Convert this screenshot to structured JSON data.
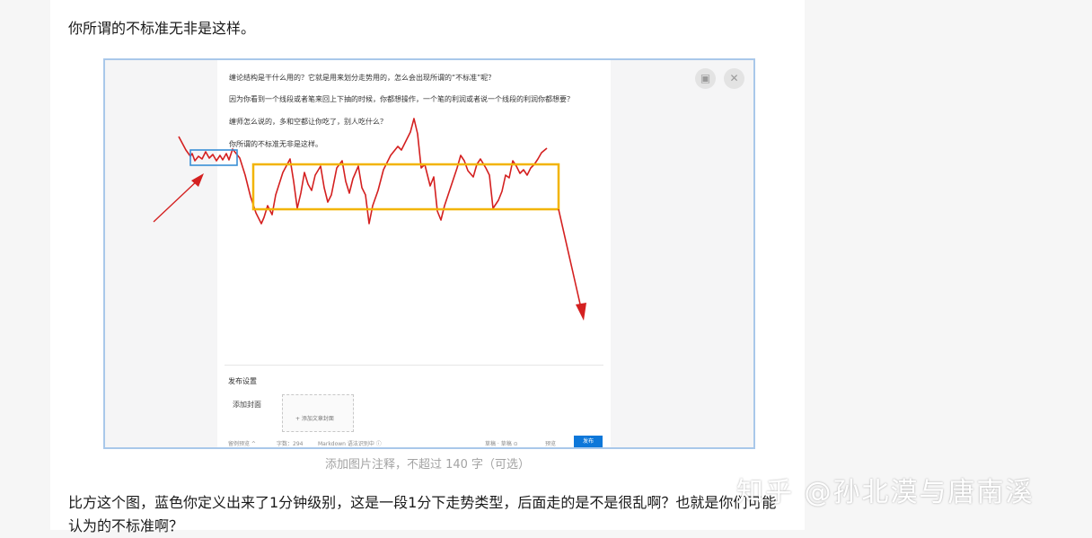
{
  "article": {
    "para1": "你所谓的不标准无非是这样。",
    "caption_placeholder": "添加图片注释，不超过 140 字（可选）",
    "para2": "比方这个图，蓝色你定义出来了1分钟级别，这是一段1分下走势类型，后面走的是不是很乱啊？也就是你们可能认为的不标准啊？"
  },
  "figure": {
    "editor_lines": [
      "缠论结构是干什么用的？它就是用来划分走势用的，怎么会出现所谓的“不标准”呢？",
      "因为你看到一个线段或者笔来回上下抽的时候，你都想操作，一个笔的利润或者说一个线段的利润你都想要？",
      "缠师怎么说的，多和空都让你吃了，别人吃什么？",
      "你所谓的不标准无非是这样。"
    ],
    "publish_settings_title": "发布设置",
    "add_cover_label": "添加封面",
    "add_cover_button": "+ 添加文章封面",
    "footer": {
      "close_preview": "留例预览 ^",
      "word_count": "字数：294",
      "markdown": "Markdown 语法识别中 ⓘ",
      "draft_status": "草稿 · 草稿 ⊙",
      "preview": "预览",
      "publish": "发布"
    },
    "icons": {
      "image_icon": "image-icon",
      "close_icon": "close-icon"
    }
  },
  "watermark": "知乎 @孙北漠与唐南溪",
  "colors": {
    "chart_line": "#d42020",
    "blue_box": "#3a8fd6",
    "yellow_box": "#f2b400",
    "arrow": "#d42020"
  }
}
